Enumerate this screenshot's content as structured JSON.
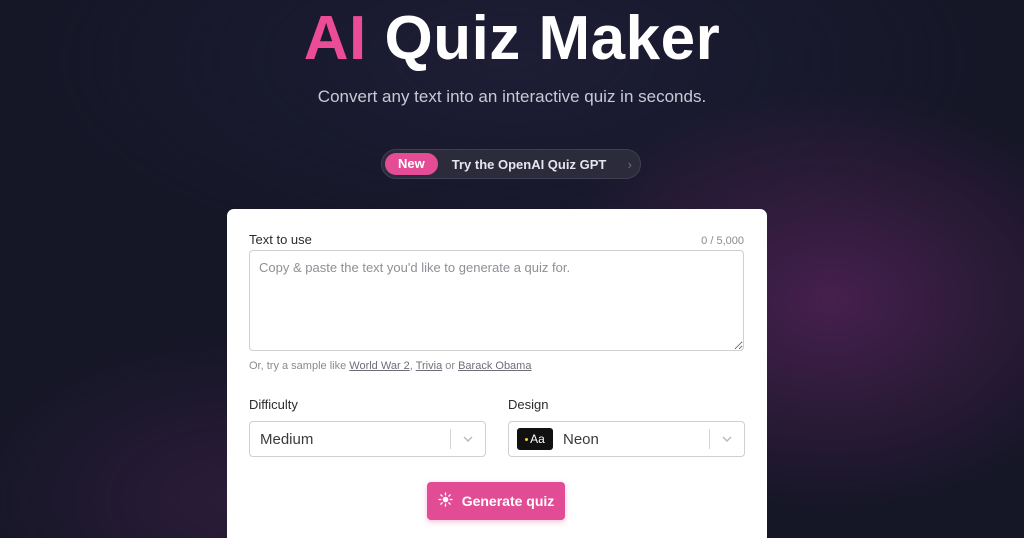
{
  "hero": {
    "title_accent": "AI",
    "title_rest": "Quiz Maker",
    "subtitle": "Convert any text into an interactive quiz in seconds."
  },
  "announcement": {
    "badge": "New",
    "text": "Try the OpenAI Quiz GPT",
    "chevron": "›"
  },
  "form": {
    "text_label": "Text to use",
    "char_counter": "0 / 5,000",
    "text_value": "",
    "text_placeholder": "Copy & paste the text you'd like to generate a quiz for.",
    "samples_prefix": "Or, try a sample like",
    "samples": [
      "World War 2",
      "Trivia",
      "Barack Obama"
    ],
    "samples_sep_1": ",",
    "samples_sep_2": "or",
    "difficulty_label": "Difficulty",
    "difficulty_value": "Medium",
    "design_label": "Design",
    "design_swatch_text": "Aa",
    "design_value": "Neon",
    "generate_label": "Generate quiz"
  },
  "colors": {
    "accent": "#e24c95",
    "background": "#151626",
    "card": "#ffffff"
  },
  "icons": {
    "announcement_chevron": "chevron-right-icon",
    "select_chevron": "chevron-down-icon",
    "generate": "lightbulb-icon"
  }
}
